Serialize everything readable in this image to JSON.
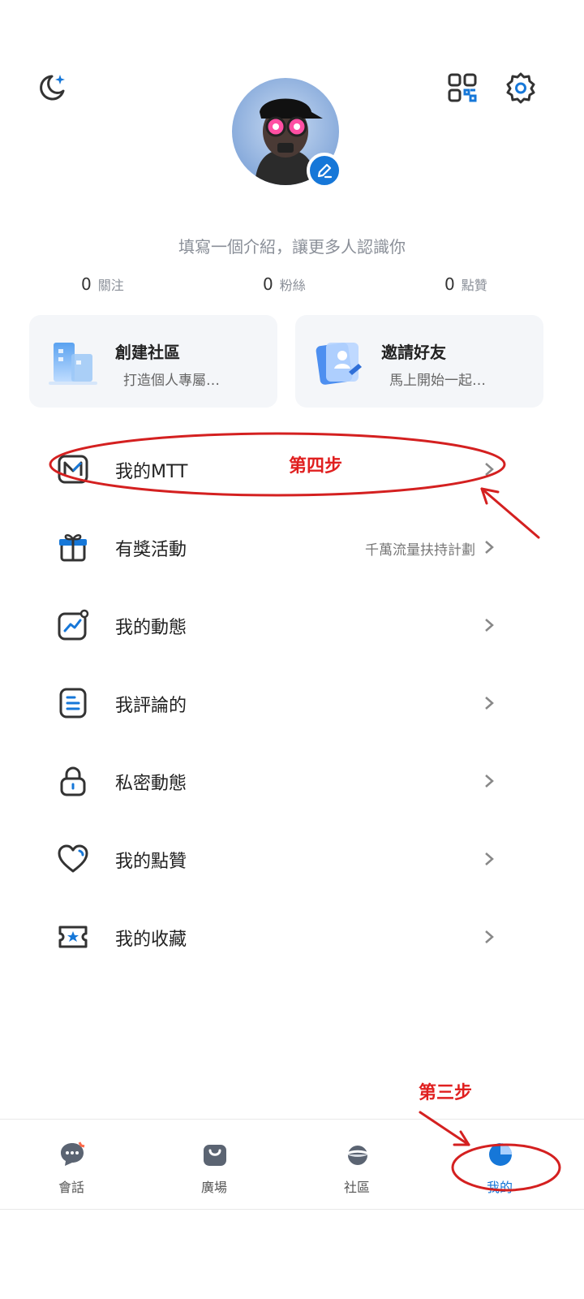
{
  "header": {
    "night_mode_icon": "moon-sparkle-icon",
    "qr_icon": "qr-code-icon",
    "settings_icon": "gear-icon"
  },
  "profile": {
    "bio_placeholder": "填寫一個介紹，讓更多人認識你",
    "edit_icon": "pencil-icon"
  },
  "stats": [
    {
      "value": "0",
      "label": "關注"
    },
    {
      "value": "0",
      "label": "粉絲"
    },
    {
      "value": "0",
      "label": "點贊"
    }
  ],
  "cards": [
    {
      "title": "創建社區",
      "subtitle": "打造個人專屬…",
      "icon": "building-icon"
    },
    {
      "title": "邀請好友",
      "subtitle": "馬上開始一起…",
      "icon": "contact-card-icon"
    }
  ],
  "menu": [
    {
      "label": "我的MTT",
      "right": "",
      "icon": "mtt-logo-icon"
    },
    {
      "label": "有獎活動",
      "right": "千萬流量扶持計劃",
      "icon": "gift-icon"
    },
    {
      "label": "我的動態",
      "right": "",
      "icon": "trend-chart-icon"
    },
    {
      "label": "我評論的",
      "right": "",
      "icon": "document-lines-icon"
    },
    {
      "label": "私密動態",
      "right": "",
      "icon": "lock-icon"
    },
    {
      "label": "我的點贊",
      "right": "",
      "icon": "heart-icon"
    },
    {
      "label": "我的收藏",
      "right": "",
      "icon": "ticket-star-icon"
    }
  ],
  "bottom_nav": [
    {
      "label": "會話",
      "icon": "chat-bubble-icon"
    },
    {
      "label": "廣場",
      "icon": "shopping-bag-icon"
    },
    {
      "label": "社區",
      "icon": "planet-icon"
    },
    {
      "label": "我的",
      "icon": "profile-circle-icon",
      "active": true
    }
  ],
  "annotations": {
    "step4": "第四步",
    "step3": "第三步"
  },
  "colors": {
    "accent": "#1677d8",
    "annotation": "#e02020",
    "icon_dark": "#333333",
    "muted_text": "#8a8f98"
  }
}
